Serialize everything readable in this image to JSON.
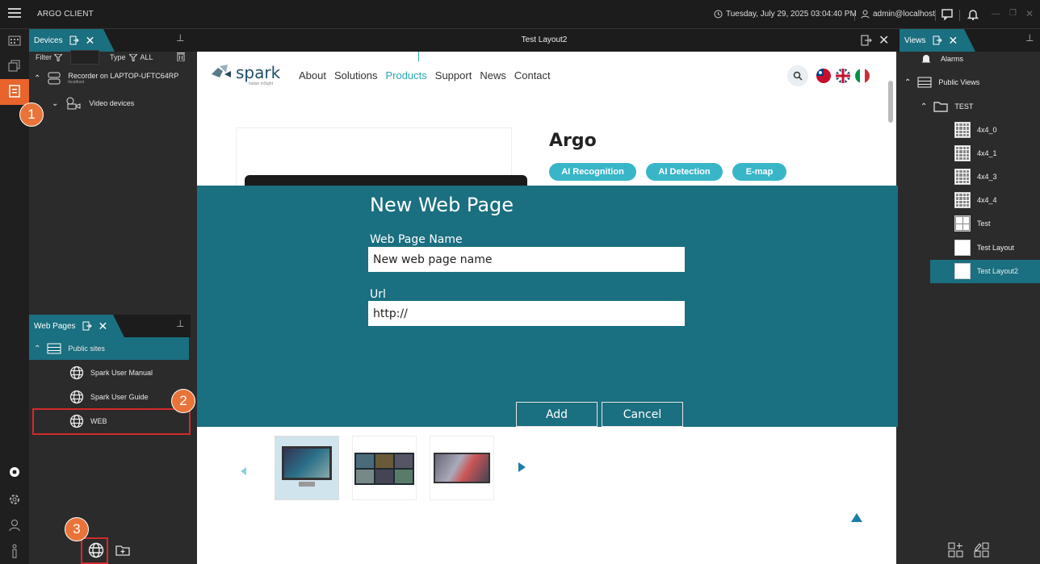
{
  "titlebar": {
    "app_title": "ARGO CLIENT",
    "datetime": "Tuesday, July 29, 2025 03:04:40 PM",
    "user": "admin@localhost"
  },
  "devices_panel": {
    "tab_label": "Devices",
    "filter_label": "Filter",
    "type_label": "Type",
    "type_value": "ALL",
    "recorder_name": "Recorder on LAPTOP-UFTC64RP",
    "recorder_host": "localhost",
    "video_devices": "Video devices"
  },
  "webpages_panel": {
    "tab_label": "Web Pages",
    "group": "Public sites",
    "items": [
      "Spark User Manual",
      "Spark User Guide",
      "WEB"
    ]
  },
  "center": {
    "layout_title": "Test Layout2"
  },
  "website": {
    "logo_text": "spark",
    "logo_sub": "Italian inSight",
    "nav": [
      "About",
      "Solutions",
      "Products",
      "Support",
      "News",
      "Contact"
    ],
    "active_nav_color": "#2aa8b8",
    "product_title": "Argo",
    "pills": [
      "AI Recognition",
      "AI Detection",
      "E-map"
    ]
  },
  "modal": {
    "title": "New Web Page",
    "name_label": "Web Page Name",
    "name_value": "New web page name",
    "url_label": "Url",
    "url_value": "http://",
    "add_label": "Add",
    "cancel_label": "Cancel"
  },
  "views_panel": {
    "tab_label": "Views",
    "alarms": "Alarms",
    "public_views": "Public Views",
    "folder": "TEST",
    "items": [
      "4x4_0",
      "4x4_1",
      "4x4_3",
      "4x4_4",
      "Test",
      "Test Layout",
      "Test Layout2"
    ],
    "selected": "Test Layout2"
  },
  "badges": [
    "1",
    "2",
    "3"
  ],
  "colors": {
    "accent": "#1a6f80",
    "orange": "#e8642c",
    "highlight_red": "#d32a2a"
  }
}
